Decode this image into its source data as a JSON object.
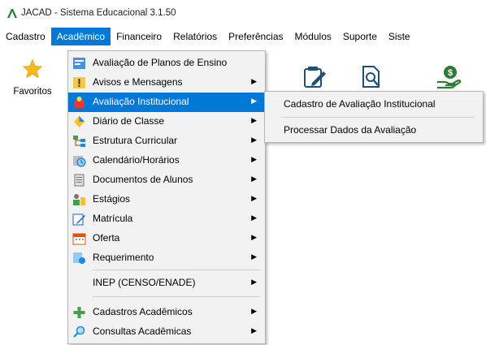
{
  "window": {
    "title": "JACAD - Sistema Educacional 3.1.50"
  },
  "menubar": [
    {
      "label": "Cadastro"
    },
    {
      "label": "Acadêmico"
    },
    {
      "label": "Financeiro"
    },
    {
      "label": "Relatórios"
    },
    {
      "label": "Preferências"
    },
    {
      "label": "Módulos"
    },
    {
      "label": "Suporte"
    },
    {
      "label": "Siste"
    }
  ],
  "toolbar": {
    "favoritos_label": "Favoritos",
    "icons": [
      "star-icon",
      "edit-form-icon",
      "document-search-icon",
      "money-hand-icon"
    ]
  },
  "academico_menu": [
    {
      "label": "Avaliação de Planos de Ensino",
      "icon": "plan-icon",
      "has_submenu": false
    },
    {
      "label": "Avisos e Mensagens",
      "icon": "warning-icon",
      "has_submenu": true
    },
    {
      "label": "Avaliação Institucional",
      "icon": "evaluation-icon",
      "has_submenu": true,
      "highlighted": true
    },
    {
      "label": "Diário de Classe",
      "icon": "diary-icon",
      "has_submenu": true
    },
    {
      "label": "Estrutura Curricular",
      "icon": "structure-icon",
      "has_submenu": true
    },
    {
      "label": "Calendário/Horários",
      "icon": "calendar-clock-icon",
      "has_submenu": true
    },
    {
      "label": "Documentos de Alunos",
      "icon": "document-icon",
      "has_submenu": true
    },
    {
      "label": "Estágios",
      "icon": "internship-icon",
      "has_submenu": true
    },
    {
      "label": "Matrícula",
      "icon": "enrollment-icon",
      "has_submenu": true
    },
    {
      "label": "Oferta",
      "icon": "calendar-icon",
      "has_submenu": true
    },
    {
      "label": "Requerimento",
      "icon": "request-icon",
      "has_submenu": true
    },
    {
      "label": "INEP (CENSO/ENADE)",
      "icon": "",
      "has_submenu": true
    },
    {
      "label": "Cadastros Acadêmicos",
      "icon": "plus-icon",
      "has_submenu": true
    },
    {
      "label": "Consultas Acadêmicas",
      "icon": "search-icon",
      "has_submenu": true
    }
  ],
  "submenu": [
    {
      "label": "Cadastro de Avaliação Institucional"
    },
    {
      "label": "Processar Dados da Avaliação"
    }
  ],
  "colors": {
    "highlight": "#0078d7",
    "menu_bg": "#f2f2f2"
  }
}
